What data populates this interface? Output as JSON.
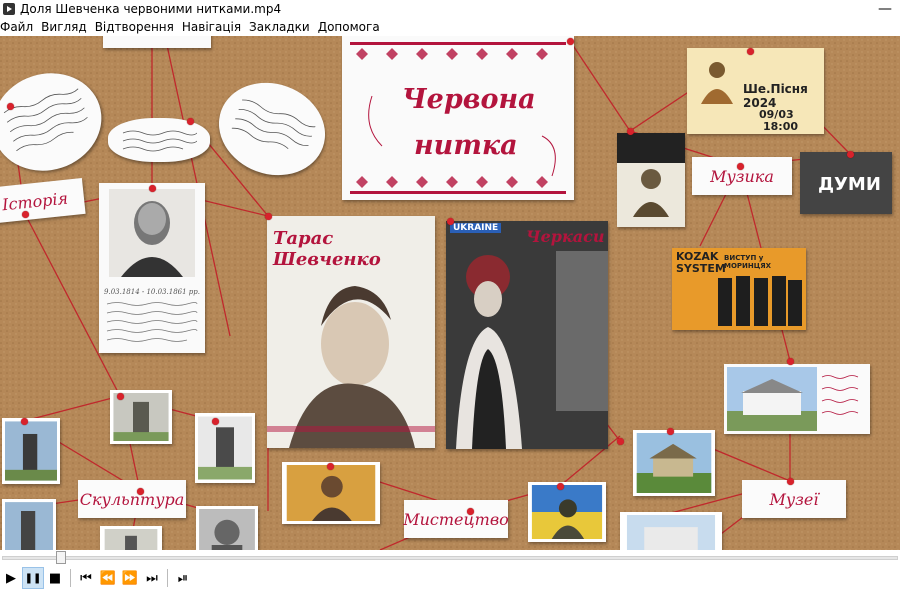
{
  "window": {
    "title": "Доля Шевченка червоними нитками.mp4",
    "minimize": "—"
  },
  "menu": [
    "Файл",
    "Вигляд",
    "Відтворення",
    "Навігація",
    "Закладки",
    "Допомога"
  ],
  "board": {
    "main_card": {
      "line1": "Червона",
      "line2": "нитка"
    },
    "poster_shevchenko": "Тарас Шевченко",
    "poster_cherkasy": "Черкаси",
    "poster_cherkasy_badge": "UKRAINE",
    "labels": {
      "history": "Історія",
      "music": "Музика",
      "sculpture": "Скульптура",
      "art": "Мистецтво",
      "museums": "Музеї"
    },
    "duma_card": "ДУМИ",
    "kozak_card": {
      "line1": "KOZAK",
      "line2": "SYSTEM",
      "line3": "ВИСТУП у МОРИНЦЯХ"
    },
    "event_card": {
      "title": "Ше.Пісня 2024",
      "date": "09/03",
      "time": "18:00"
    },
    "portrait_dates": "9.03.1814 - 10.03.1861 рр."
  },
  "player": {
    "progress": 0.06,
    "buttons": {
      "play": "▶",
      "pause": "❚❚",
      "stop": "■",
      "prev": "⏮",
      "rewind": "⏪",
      "forward": "⏩",
      "next": "⏭",
      "frame": "⏯"
    }
  },
  "colors": {
    "cork": "#b58858",
    "thread": "#c0282c",
    "accent": "#b3143d"
  }
}
